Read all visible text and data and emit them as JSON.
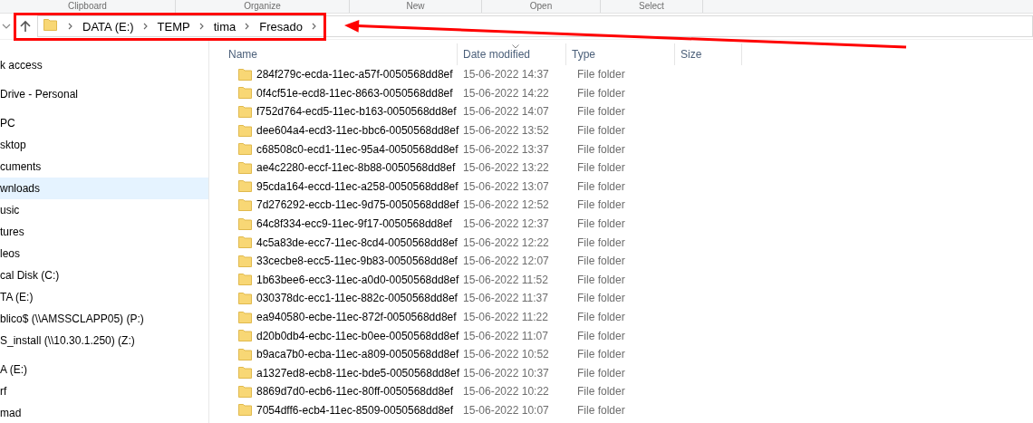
{
  "ribbon_groups": [
    "Clipboard",
    "Organize",
    "New",
    "Open",
    "Select"
  ],
  "address_bar": {
    "highlighted": true,
    "path": [
      "DATA (E:)",
      "TEMP",
      "tima",
      "Fresado"
    ]
  },
  "annotation": {
    "kind": "arrow"
  },
  "sidebar": {
    "sections": [
      {
        "items": [
          {
            "label": "k access",
            "selected": false
          }
        ]
      },
      {
        "items": [
          {
            "label": "Drive - Personal",
            "selected": false
          }
        ]
      },
      {
        "items": [
          {
            "label": "PC",
            "selected": false
          },
          {
            "label": "sktop",
            "selected": false
          },
          {
            "label": "cuments",
            "selected": false
          },
          {
            "label": "wnloads",
            "selected": true
          },
          {
            "label": "usic",
            "selected": false
          },
          {
            "label": "tures",
            "selected": false
          },
          {
            "label": "leos",
            "selected": false
          },
          {
            "label": "cal Disk (C:)",
            "selected": false
          },
          {
            "label": "TA (E:)",
            "selected": false
          },
          {
            "label": "blico$ (\\\\AMSSCLAPP05) (P:)",
            "selected": false
          },
          {
            "label": "S_install (\\\\10.30.1.250) (Z:)",
            "selected": false
          }
        ]
      },
      {
        "items": [
          {
            "label": "A (E:)",
            "selected": false
          },
          {
            "label": "rf",
            "selected": false
          },
          {
            "label": "mad",
            "selected": false
          }
        ]
      }
    ]
  },
  "file_list": {
    "columns": [
      {
        "label": "Name",
        "sorted": false
      },
      {
        "label": "Date modified",
        "sorted": true
      },
      {
        "label": "Type",
        "sorted": false
      },
      {
        "label": "Size",
        "sorted": false
      }
    ],
    "rows": [
      {
        "name": "284f279c-ecda-11ec-a57f-0050568dd8ef",
        "date": "15-06-2022 14:37",
        "type": "File folder"
      },
      {
        "name": "0f4cf51e-ecd8-11ec-8663-0050568dd8ef",
        "date": "15-06-2022 14:22",
        "type": "File folder"
      },
      {
        "name": "f752d764-ecd5-11ec-b163-0050568dd8ef",
        "date": "15-06-2022 14:07",
        "type": "File folder"
      },
      {
        "name": "dee604a4-ecd3-11ec-bbc6-0050568dd8ef",
        "date": "15-06-2022 13:52",
        "type": "File folder"
      },
      {
        "name": "c68508c0-ecd1-11ec-95a4-0050568dd8ef",
        "date": "15-06-2022 13:37",
        "type": "File folder"
      },
      {
        "name": "ae4c2280-eccf-11ec-8b88-0050568dd8ef",
        "date": "15-06-2022 13:22",
        "type": "File folder"
      },
      {
        "name": "95cda164-eccd-11ec-a258-0050568dd8ef",
        "date": "15-06-2022 13:07",
        "type": "File folder"
      },
      {
        "name": "7d276292-eccb-11ec-9d75-0050568dd8ef",
        "date": "15-06-2022 12:52",
        "type": "File folder"
      },
      {
        "name": "64c8f334-ecc9-11ec-9f17-0050568dd8ef",
        "date": "15-06-2022 12:37",
        "type": "File folder"
      },
      {
        "name": "4c5a83de-ecc7-11ec-8cd4-0050568dd8ef",
        "date": "15-06-2022 12:22",
        "type": "File folder"
      },
      {
        "name": "33cecbe8-ecc5-11ec-9b83-0050568dd8ef",
        "date": "15-06-2022 12:07",
        "type": "File folder"
      },
      {
        "name": "1b63bee6-ecc3-11ec-a0d0-0050568dd8ef",
        "date": "15-06-2022 11:52",
        "type": "File folder"
      },
      {
        "name": "030378dc-ecc1-11ec-882c-0050568dd8ef",
        "date": "15-06-2022 11:37",
        "type": "File folder"
      },
      {
        "name": "ea940580-ecbe-11ec-872f-0050568dd8ef",
        "date": "15-06-2022 11:22",
        "type": "File folder"
      },
      {
        "name": "d20b0db4-ecbc-11ec-b0ee-0050568dd8ef",
        "date": "15-06-2022 11:07",
        "type": "File folder"
      },
      {
        "name": "b9aca7b0-ecba-11ec-a809-0050568dd8ef",
        "date": "15-06-2022 10:52",
        "type": "File folder"
      },
      {
        "name": "a1327ed8-ecb8-11ec-bde5-0050568dd8ef",
        "date": "15-06-2022 10:37",
        "type": "File folder"
      },
      {
        "name": "8869d7d0-ecb6-11ec-80ff-0050568dd8ef",
        "date": "15-06-2022 10:22",
        "type": "File folder"
      },
      {
        "name": "7054dff6-ecb4-11ec-8509-0050568dd8ef",
        "date": "15-06-2022 10:07",
        "type": "File folder"
      }
    ]
  }
}
